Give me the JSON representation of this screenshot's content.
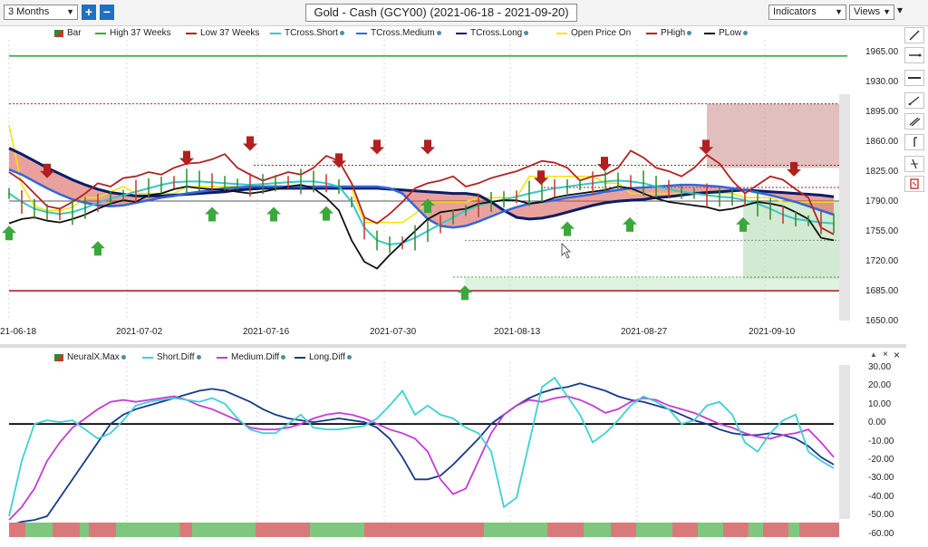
{
  "toolbar": {
    "period": "3 Months",
    "zoom_in": "+",
    "zoom_out": "−",
    "title": "Gold - Cash (GCY00) (2021-06-18 - 2021-09-20)",
    "indicators": "Indicators",
    "views": "Views",
    "views_menu": "▾"
  },
  "price_legend": [
    {
      "label": "Bar",
      "color": "#2e8b2e",
      "kind": "bar"
    },
    {
      "label": "High 37 Weeks",
      "color": "#3aa83a",
      "kind": "line"
    },
    {
      "label": "Low 37 Weeks",
      "color": "#b22222",
      "kind": "line"
    },
    {
      "label": "TCross.Short",
      "color": "#39c6c6",
      "kind": "line",
      "dot": true
    },
    {
      "label": "TCross.Medium",
      "color": "#3366dd",
      "kind": "line",
      "dot": true
    },
    {
      "label": "TCross.Long",
      "color": "#0a1d66",
      "kind": "line",
      "dot": true
    },
    {
      "label": "Open Price On",
      "color": "#f2e500",
      "kind": "line"
    },
    {
      "label": "PHigh",
      "color": "#b22222",
      "kind": "line",
      "dot": true
    },
    {
      "label": "PLow",
      "color": "#111111",
      "kind": "line",
      "dot": true
    }
  ],
  "price_axis": [
    "1965.00",
    "1930.00",
    "1895.00",
    "1860.00",
    "1825.00",
    "1790.00",
    "1755.00",
    "1720.00",
    "1685.00",
    "1650.00"
  ],
  "date_axis": [
    "21-06-18",
    "2021-07-02",
    "2021-07-16",
    "2021-07-30",
    "2021-08-13",
    "2021-08-27",
    "2021-09-10"
  ],
  "osc_legend": [
    {
      "label": "NeuralX.Max",
      "color": "#c0392b",
      "kind": "bar",
      "dot": true
    },
    {
      "label": "Short.Diff",
      "color": "#3fd1d1",
      "kind": "line",
      "dot": true
    },
    {
      "label": "Medium.Diff",
      "color": "#c43cd6",
      "kind": "line",
      "dot": true
    },
    {
      "label": "Long.Diff",
      "color": "#173a8a",
      "kind": "line",
      "dot": true
    }
  ],
  "osc_axis": [
    "30.00",
    "20.00",
    "10.00",
    "0.00",
    "-10.00",
    "-20.00",
    "-30.00",
    "-40.00",
    "-50.00",
    "-60.00"
  ],
  "osc_close": "×",
  "osc_collapse": "▲",
  "series": {
    "colors": {
      "phigh": "#b22222",
      "plow": "#111111",
      "short": "#39c6c6",
      "medium": "#3366dd",
      "long": "#0a1d66",
      "open": "#f2e500",
      "high37": "#3aa83a",
      "low37": "#b22222"
    }
  }
}
